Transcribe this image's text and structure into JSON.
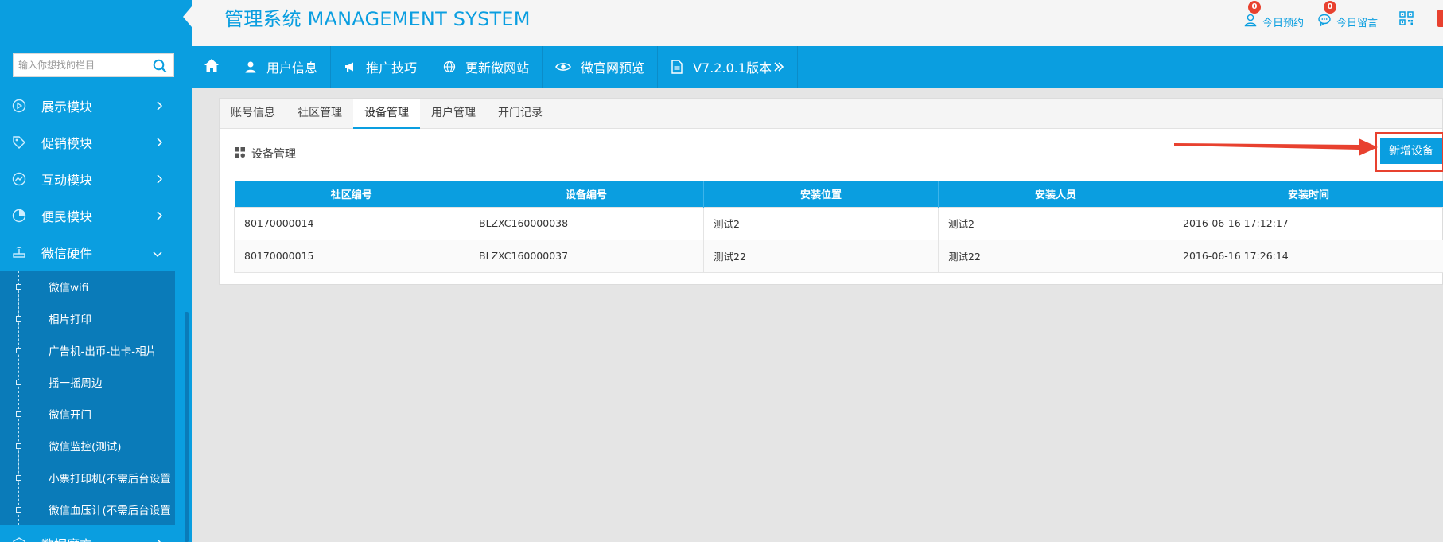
{
  "app": {
    "title": "管理系统 MANAGEMENT SYSTEM"
  },
  "header": {
    "appointments": {
      "badge": "0",
      "label": "今日预约",
      "icon": "user-icon"
    },
    "messages": {
      "badge": "0",
      "label": "今日留言",
      "icon": "chat-bubble-icon"
    },
    "qr_icon": "qr-code-icon"
  },
  "sidebar": {
    "search_placeholder": "输入你想找的栏目",
    "menu": [
      {
        "label": "展示模块",
        "icon": "play-circle-icon"
      },
      {
        "label": "促销模块",
        "icon": "tag-icon"
      },
      {
        "label": "互动模块",
        "icon": "chart-circle-icon"
      },
      {
        "label": "便民模块",
        "icon": "pie-chart-icon"
      },
      {
        "label": "微信硬件",
        "icon": "router-icon",
        "expanded": true
      }
    ],
    "submenu": [
      "微信wifi",
      "相片打印",
      "广告机-出币-出卡-相片",
      "摇一摇周边",
      "微信开门",
      "微信监控(测试)",
      "小票打印机(不需后台设置",
      "微信血压计(不需后台设置"
    ],
    "next_menu": "数据魔方"
  },
  "topnav": {
    "items": [
      {
        "label": "用户信息",
        "icon": "user-icon"
      },
      {
        "label": "推广技巧",
        "icon": "megaphone-icon"
      },
      {
        "label": "更新微网站",
        "icon": "globe-icon"
      },
      {
        "label": "微官网预览",
        "icon": "eye-icon"
      },
      {
        "label": "V7.2.0.1版本",
        "icon": "document-icon"
      }
    ]
  },
  "tabs": [
    "账号信息",
    "社区管理",
    "设备管理",
    "用户管理",
    "开门记录"
  ],
  "active_tab": "设备管理",
  "section": {
    "title": "设备管理",
    "add_button": "新增设备"
  },
  "table": {
    "headers": [
      "社区编号",
      "设备编号",
      "安装位置",
      "安装人员",
      "安装时间"
    ],
    "rows": [
      [
        "80170000014",
        "BLZXC160000038",
        "测试2",
        "测试2",
        "2016-06-16 17:12:17"
      ],
      [
        "80170000015",
        "BLZXC160000037",
        "测试22",
        "测试22",
        "2016-06-16 17:26:14"
      ]
    ]
  },
  "colors": {
    "primary": "#0a9ee0",
    "sidebar_submenu": "#0a7bb9",
    "badge": "#e8412f",
    "annotation": "#e8412f"
  }
}
